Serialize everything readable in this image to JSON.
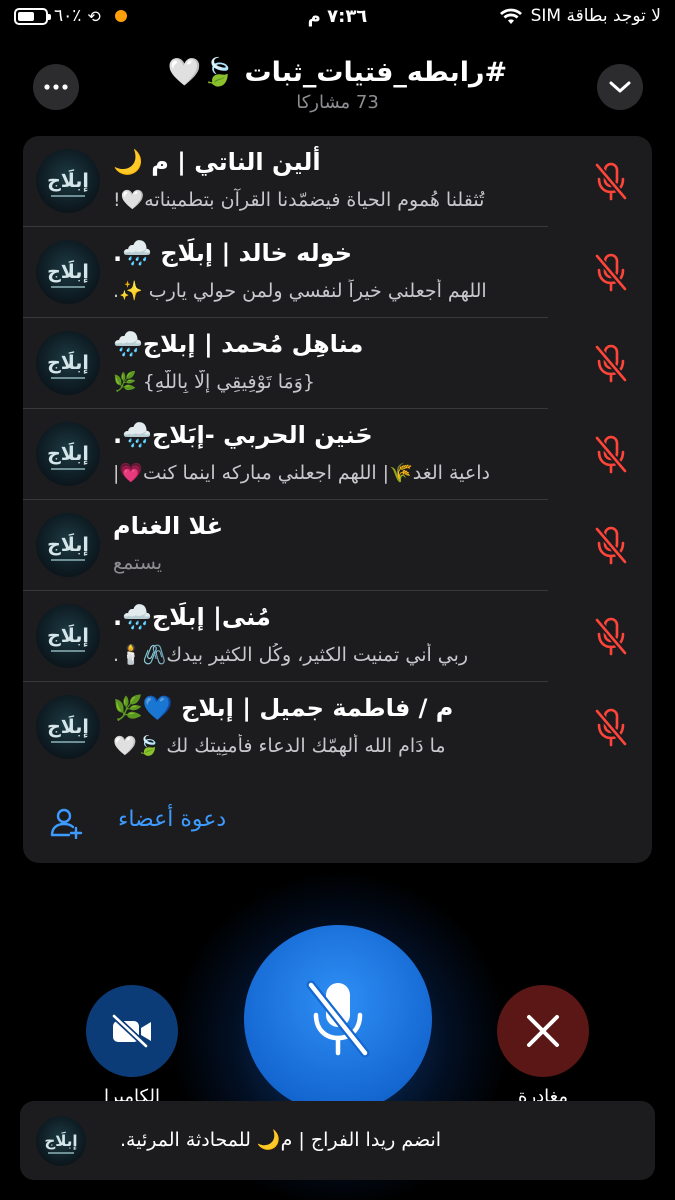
{
  "status_bar": {
    "battery_percent_label": "٦٠٪",
    "battery_level": 0.6,
    "time": "٧:٣٦ م",
    "carrier": "لا توجد بطاقة SIM"
  },
  "header": {
    "title": "#رابطه_فتيات_ثبات 🍃🤍",
    "participants_count": "73 مشاركا"
  },
  "participants": [
    {
      "name": "ألين الناتي | م 🌙",
      "status": "تُثقلنا هُموم الحياة فيضمّدنا القرآن بتطميناته🤍!"
    },
    {
      "name": "خوله خالد | إبلَاج 🌧️.",
      "status": "اللهم أجعلني خيراً لنفسي ولمن حولي يارب ✨."
    },
    {
      "name": "مناهِل مُحمد | إبلاج🌧️",
      "status": "{وَمَا تَوْفِيقِي إِلَّا بِاللَّهِ} 🌿"
    },
    {
      "name": "حَنين الحربي -إبَلاج🌧️.",
      "status": "داعية الغد🌾| اللهم اجعلني مباركه اينما كنت💗|"
    },
    {
      "name": "غلا الغنام",
      "status": "يستمع"
    },
    {
      "name": "مُنى| إبلَاج🌧️.",
      "status": "ربي أني تمنيت الكثير، وكُل الكثير بيدك🖇️🕯️."
    },
    {
      "name": "م / فاطمة جميل | إبلاج 💙🌿",
      "status": "ما دَام الله ألهمّك الدعاء فأمنِيتك لك 🍃🤍"
    }
  ],
  "avatar_text": "إبلَاج",
  "invite": {
    "label": "دعوة أعضاء"
  },
  "controls": {
    "camera_label": "الكاميرا",
    "leave_label": "مغادرة"
  },
  "toast": {
    "text": "انضم ريدا الفراج | م🌙 للمحادثة المرئية."
  },
  "colors": {
    "accent_blue": "#1567d1",
    "muted_red": "#ff453a",
    "link_blue": "#3d9bff",
    "panel": "#1c1c1e"
  }
}
